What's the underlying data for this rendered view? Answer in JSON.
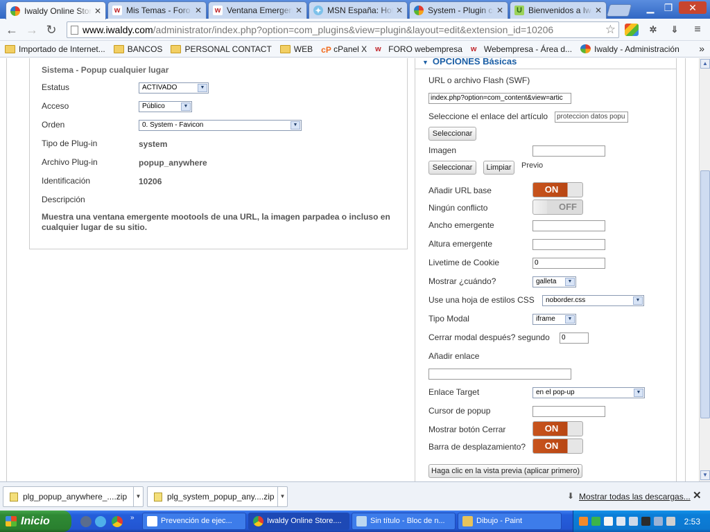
{
  "browser": {
    "tabs": [
      {
        "title": "Iwaldy Online Store",
        "active": true
      },
      {
        "title": "Mis Temas - Foro",
        "active": false
      },
      {
        "title": "Ventana Emergente",
        "active": false
      },
      {
        "title": "MSN España: Hotmail",
        "active": false
      },
      {
        "title": "System - Plugin cu",
        "active": false
      },
      {
        "title": "Bienvenidos a Iwaldy",
        "active": false
      }
    ],
    "url_host": "www.iwaldy.com",
    "url_path": "/administrator/index.php?option=com_plugins&view=plugin&layout=edit&extension_id=10206",
    "bookmarks": [
      {
        "label": "Importado de Internet...",
        "type": "folder"
      },
      {
        "label": "BANCOS",
        "type": "folder"
      },
      {
        "label": "PERSONAL CONTACT",
        "type": "folder"
      },
      {
        "label": "WEB",
        "type": "folder"
      },
      {
        "label": "cPanel X",
        "type": "cpanel"
      },
      {
        "label": "FORO webempresa",
        "type": "w"
      },
      {
        "label": "Webempresa - Área d...",
        "type": "w"
      },
      {
        "label": "Iwaldy - Administración",
        "type": "joomla"
      }
    ],
    "bookmarks_more": "»"
  },
  "plugin": {
    "title": "Sistema - Popup cualquier lugar",
    "status_label": "Estatus",
    "status_value": "ACTIVADO",
    "access_label": "Acceso",
    "access_value": "Público",
    "order_label": "Orden",
    "order_value": "0. System - Favicon",
    "type_label": "Tipo de Plug-in",
    "type_value": "system",
    "file_label": "Archivo Plug-in",
    "file_value": "popup_anywhere",
    "id_label": "Identificación",
    "id_value": "10206",
    "desc_label": "Descripción",
    "desc_text": "Muestra una ventana emergente mootools de una URL, la imagen parpadea o incluso en cualquier lugar de su sitio."
  },
  "options": {
    "header": "OPCIONES Básicas",
    "url_label": "URL o archivo Flash (SWF)",
    "url_value": "index.php?option=com_content&view=artic",
    "article_label": "Seleccione el enlace del artículo",
    "article_value": "proteccion datos popu",
    "select_btn": "Seleccionar",
    "image_label": "Imagen",
    "image_value": "",
    "image_select_btn": "Seleccionar",
    "clear_btn": "Limpiar",
    "preview_label": "Previo",
    "base_url_label": "Añadir URL base",
    "base_url_state": "ON",
    "no_conflict_label": "Ningún conflicto",
    "no_conflict_state": "OFF",
    "width_label": "Ancho emergente",
    "width_value": "",
    "height_label": "Altura emergente",
    "height_value": "",
    "cookie_label": "Livetime de Cookie",
    "cookie_value": "0",
    "show_when_label": "Mostrar ¿cuándo?",
    "show_when_value": "galleta",
    "css_label": "Use una hoja de estilos CSS",
    "css_value": "noborder.css",
    "modal_type_label": "Tipo Modal",
    "modal_type_value": "iframe",
    "close_after_label": "Cerrar modal después? segundo",
    "close_after_value": "0",
    "add_link_label": "Añadir enlace",
    "add_link_value": "",
    "target_label": "Enlace Target",
    "target_value": "en el pop-up",
    "cursor_label": "Cursor de popup",
    "cursor_value": "",
    "show_close_label": "Mostrar botón Cerrar",
    "show_close_state": "ON",
    "scrollbar_label": "Barra de desplazamiento?",
    "scrollbar_state": "ON",
    "preview_btn": "Haga clic en la vista previa (aplicar primero)"
  },
  "downloads": {
    "items": [
      "plg_popup_anywhere_....zip",
      "plg_system_popup_any....zip"
    ],
    "show_all": "Mostrar todas las descargas..."
  },
  "taskbar": {
    "start": "Inicio",
    "windows": [
      {
        "title": "Prevención de ejec...",
        "active": false
      },
      {
        "title": "Iwaldy Online Store....",
        "active": true
      },
      {
        "title": "Sin título - Bloc de n...",
        "active": false
      },
      {
        "title": "Dibujo - Paint",
        "active": false
      }
    ],
    "clock": "2:53"
  },
  "colors": {
    "toggle_on": "#c8541d",
    "header_blue": "#1a5ea5",
    "taskbar_blue": "#245edb",
    "start_green": "#2f8a35"
  }
}
